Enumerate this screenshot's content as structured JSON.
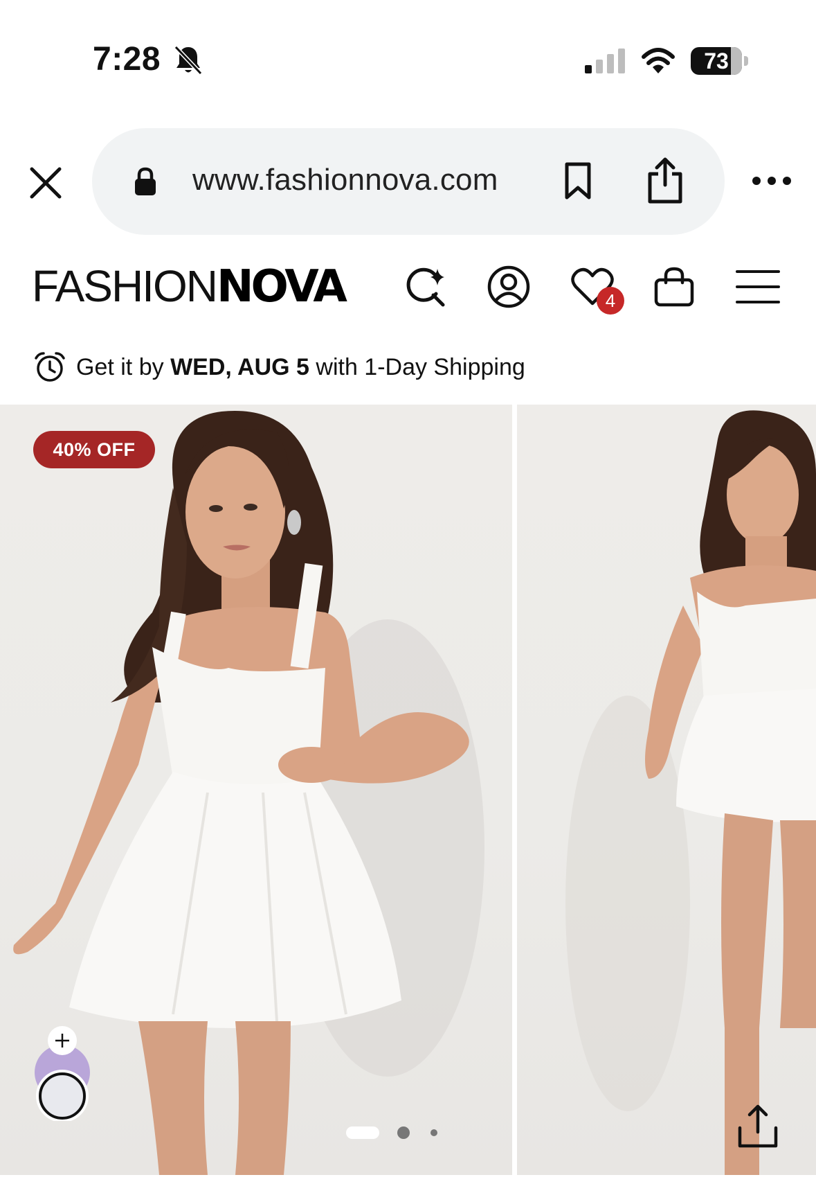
{
  "status_bar": {
    "time": "7:28",
    "battery_level": "73",
    "icons": [
      "bell-slash-icon",
      "cellular-signal-icon",
      "wifi-icon",
      "battery-icon"
    ]
  },
  "browser": {
    "url": "www.fashionnova.com",
    "icons": [
      "close-icon",
      "lock-icon",
      "bookmark-icon",
      "share-icon",
      "more-icon"
    ]
  },
  "header": {
    "logo_light": "FASHION",
    "logo_bold": "NOVA",
    "wishlist_count": "4",
    "icons": [
      "ai-search-icon",
      "account-icon",
      "heart-icon",
      "shopping-bag-icon",
      "hamburger-menu-icon"
    ]
  },
  "shipping": {
    "prefix": "Get it by ",
    "date": "WED, AUG 5",
    "suffix": " with 1-Day Shipping",
    "icon": "alarm-clock-icon"
  },
  "gallery": {
    "badge": "40% OFF",
    "slide_count": 3,
    "active_slide": 1,
    "colors": {
      "badge": "#a52626",
      "background": "#eeece9",
      "swatch": "#b9a6d9"
    }
  }
}
